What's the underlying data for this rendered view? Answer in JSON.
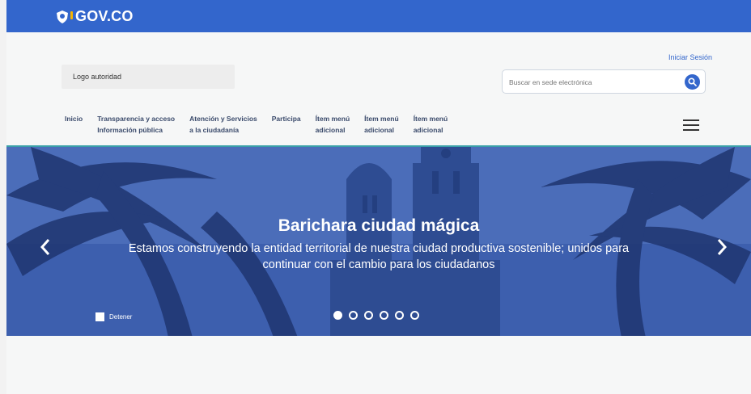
{
  "topbar": {
    "brand": "GOV.CO",
    "brand_color": "#3366cc"
  },
  "header": {
    "login_label": "Iniciar Sesión",
    "logo_authority": "Logo autoridad",
    "search": {
      "placeholder": "Buscar en sede electrónica",
      "value": "",
      "icon": "search-icon"
    }
  },
  "nav": {
    "items": [
      {
        "label": "Inicio"
      },
      {
        "label": "Transparencia y acceso\nInformación pública"
      },
      {
        "label": "Atención y Servicios\na la ciudadanía"
      },
      {
        "label": "Participa"
      },
      {
        "label": "Ítem menú\nadicional"
      },
      {
        "label": "Ítem menú\nadicional"
      },
      {
        "label": "Ítem menú\nadicional"
      }
    ],
    "menu_icon": "hamburger-menu-icon"
  },
  "hero": {
    "title": "Barichara ciudad mágica",
    "subtitle": "Estamos construyendo la entidad territorial de nuestra ciudad productiva sostenible; unidos para continuar con el cambio para los ciudadanos",
    "stop_label": "Detener",
    "slides_total": 6,
    "active_slide": 1,
    "overlay_color": "#2d4fa0"
  }
}
